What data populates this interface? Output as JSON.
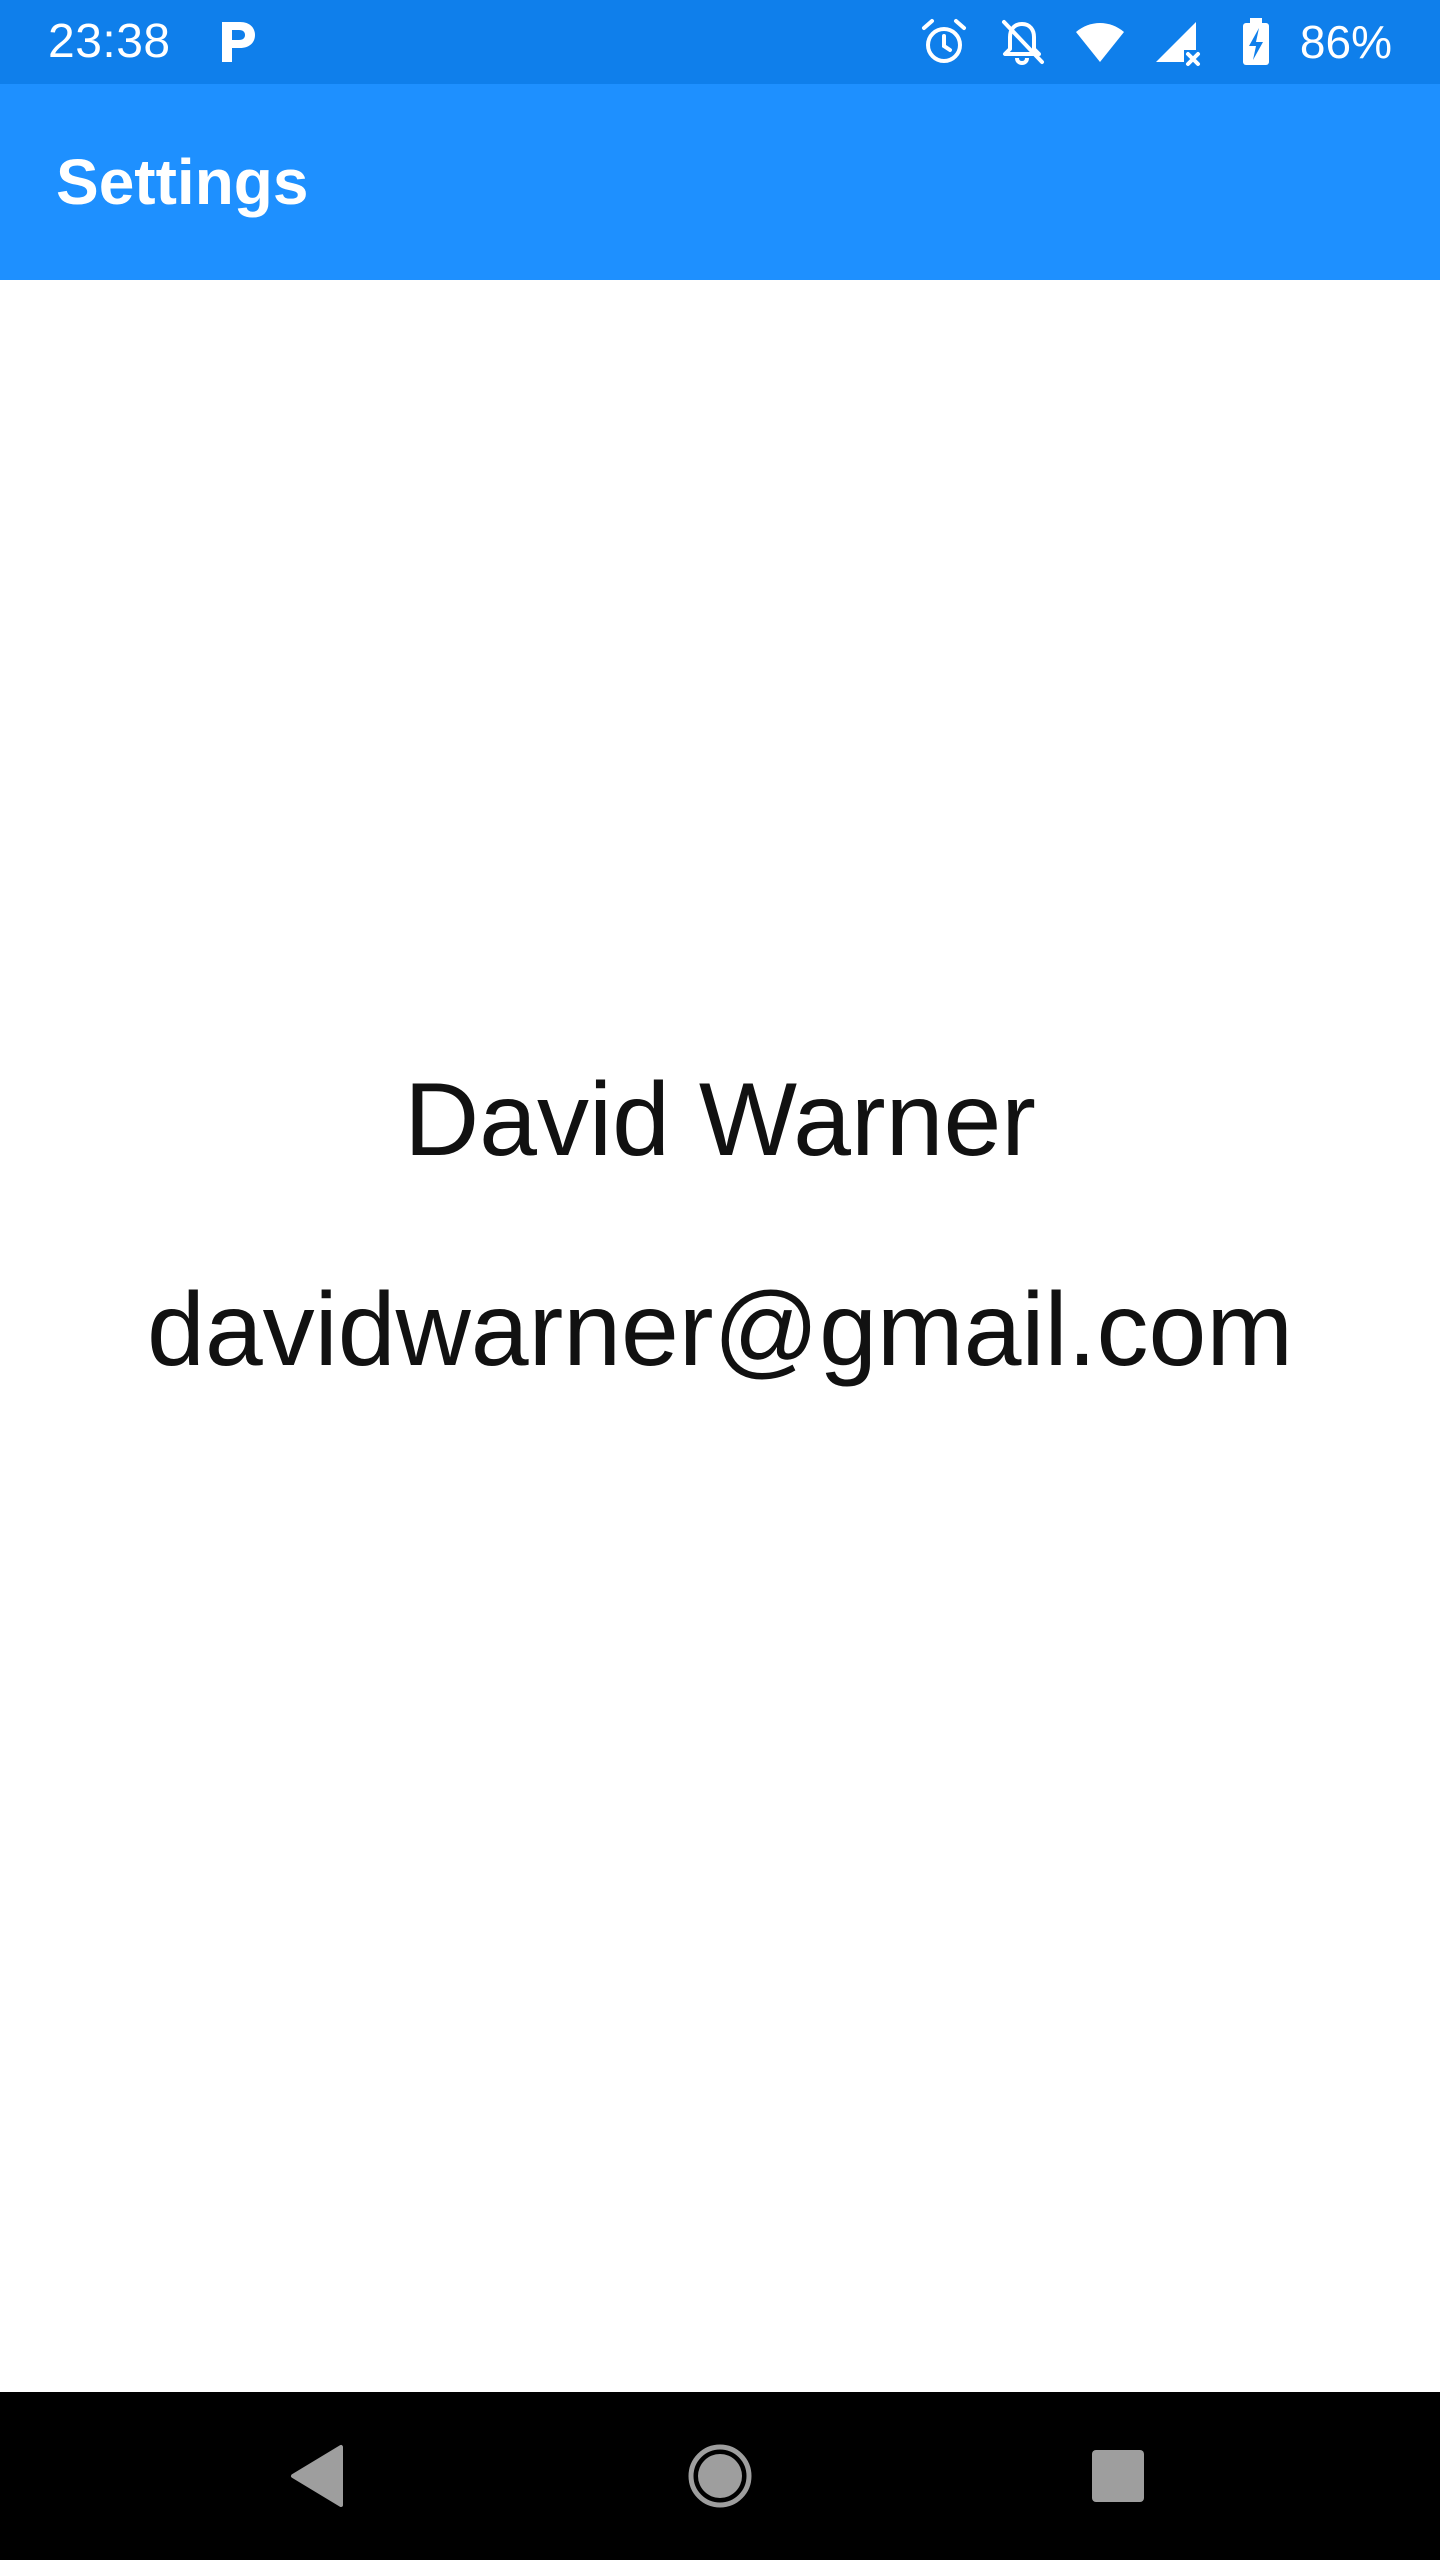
{
  "status_bar": {
    "time": "23:38",
    "battery_percent": "86%",
    "icons": [
      "parking-icon",
      "alarm-icon",
      "notifications-off-icon",
      "wifi-icon",
      "cell-signal-icon",
      "battery-charging-icon"
    ],
    "background_color": "#0F7FEB"
  },
  "app_bar": {
    "title": "Settings",
    "background_color": "#1E90FF"
  },
  "profile": {
    "name": "David Warner",
    "email": "davidwarner@gmail.com"
  },
  "nav_bar": {
    "buttons": [
      "back-icon",
      "home-icon",
      "recents-icon"
    ]
  }
}
